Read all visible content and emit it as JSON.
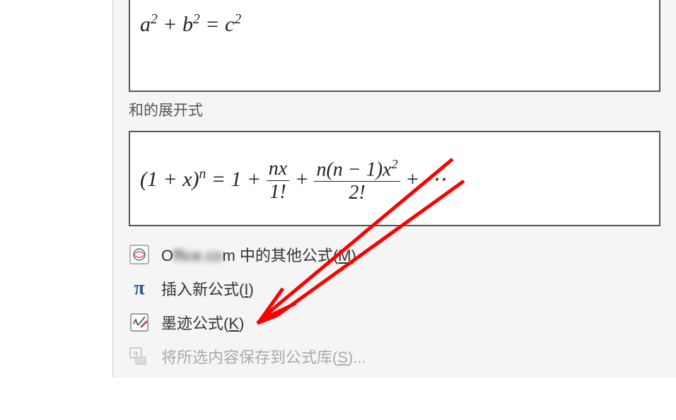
{
  "section_label": "和的展开式",
  "equations": {
    "pythagorean": {
      "a": "a",
      "b": "b",
      "c": "c"
    },
    "binomial": {
      "base": "(1 + x)",
      "exp": "n",
      "t1": "1",
      "f1n": "nx",
      "f1d": "1!",
      "f2n": "n(n − 1)x",
      "f2e": "2",
      "f2d": "2!",
      "tail": "+ ⋯"
    }
  },
  "menu": {
    "office_prefix": "O",
    "office_blur": "ffice.co",
    "office_suffix": "m 中的其他公式(",
    "office_key": "M",
    "office_close": ")",
    "insert_label": "插入新公式(",
    "insert_key": "I",
    "insert_close": ")",
    "ink_label": "墨迹公式(",
    "ink_key": "K",
    "ink_close": ")",
    "save_label": "将所选内容保存到公式库(",
    "save_key": "S",
    "save_close": ")..."
  }
}
